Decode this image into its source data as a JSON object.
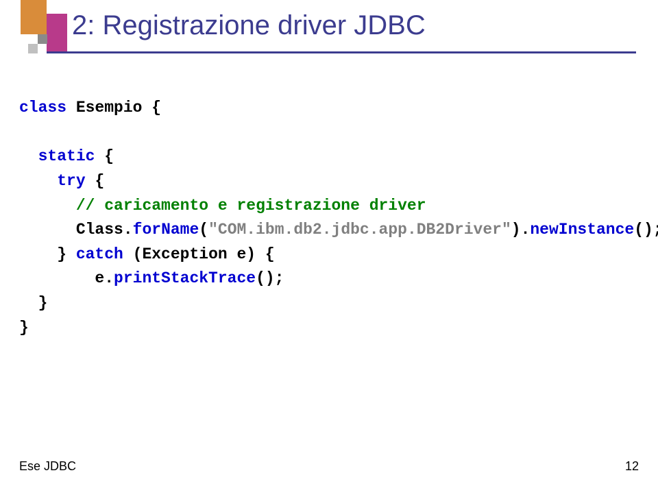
{
  "title": "2: Registrazione driver JDBC",
  "code": {
    "line1": {
      "kw1": "class",
      "pl1": " Esempio {"
    },
    "line2": "",
    "line3": {
      "kw1": "static",
      "pl1": " {"
    },
    "line4": {
      "kw1": "try",
      "pl1": " {"
    },
    "line5": {
      "cm1": "// caricamento e registrazione driver"
    },
    "line6": {
      "pl1": "Class.",
      "kw1": "forName",
      "pl2": "(",
      "str1": "\"COM.ibm.db2.jdbc.app.DB2Driver\"",
      "pl3": ").",
      "kw2": "newInstance",
      "pl4": "();"
    },
    "line7": {
      "pl1": "} ",
      "kw1": "catch",
      "pl2": " (Exception e) {"
    },
    "line8": {
      "pl1": "e.",
      "kw1": "printStackTrace",
      "pl2": "();"
    },
    "line9": {
      "pl1": "}"
    },
    "line10": {
      "pl1": "}"
    }
  },
  "footer": {
    "left": "Ese JDBC",
    "pageNumber": "12"
  }
}
